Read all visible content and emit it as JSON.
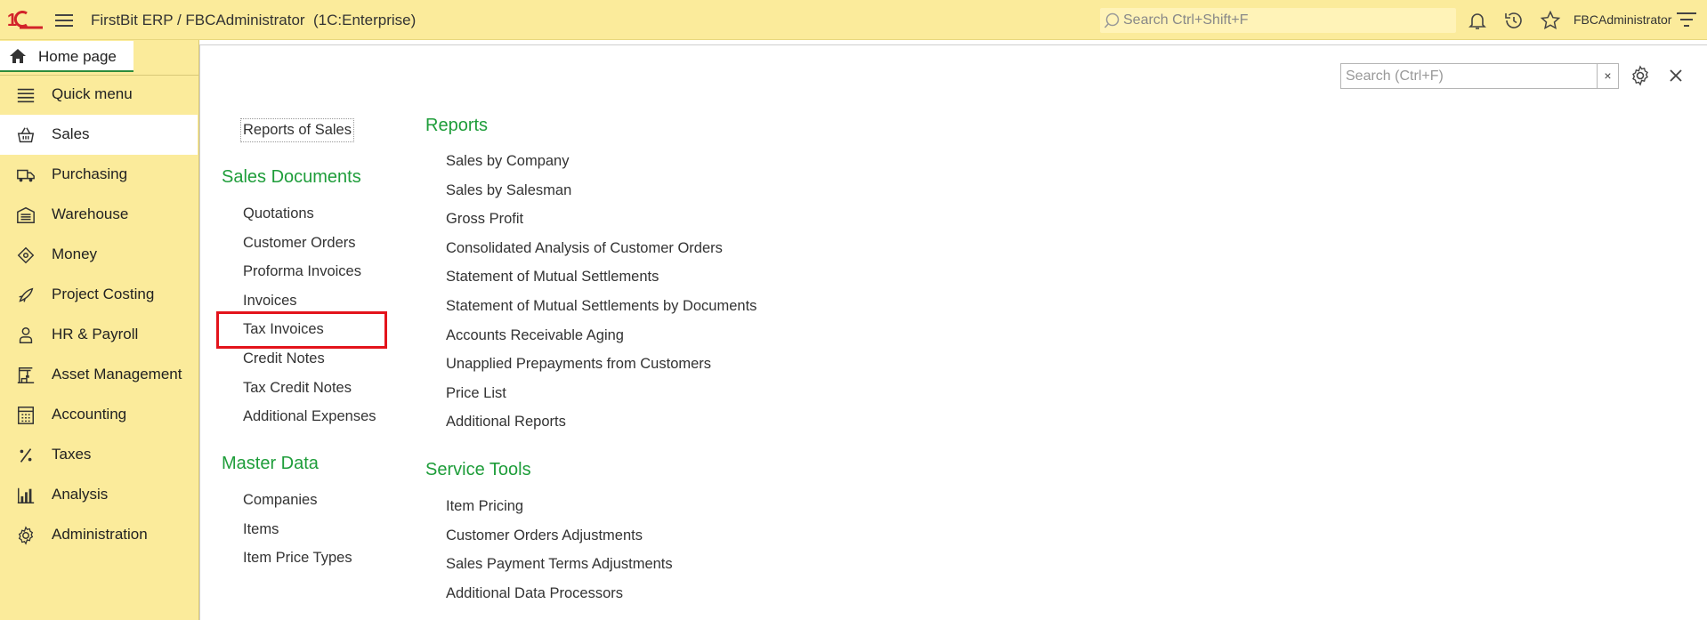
{
  "topbar": {
    "title": "FirstBit ERP / FBCAdministrator  (1C:Enterprise)",
    "search_placeholder": "Search Ctrl+Shift+F",
    "user": "FBCAdministrator"
  },
  "home_tab": "Home page",
  "sidebar": {
    "items": [
      {
        "label": "Quick menu",
        "icon": "list-icon"
      },
      {
        "label": "Sales",
        "icon": "basket-icon"
      },
      {
        "label": "Purchasing",
        "icon": "truck-icon"
      },
      {
        "label": "Warehouse",
        "icon": "warehouse-icon"
      },
      {
        "label": "Money",
        "icon": "money-icon"
      },
      {
        "label": "Project Costing",
        "icon": "rocket-icon"
      },
      {
        "label": "HR & Payroll",
        "icon": "person-icon"
      },
      {
        "label": "Asset Management",
        "icon": "crane-icon"
      },
      {
        "label": "Accounting",
        "icon": "calculator-icon"
      },
      {
        "label": "Taxes",
        "icon": "percent-icon"
      },
      {
        "label": "Analysis",
        "icon": "bar-chart-icon"
      },
      {
        "label": "Administration",
        "icon": "gear-icon"
      }
    ],
    "active": "Sales"
  },
  "panel": {
    "search_placeholder": "Search (Ctrl+F)",
    "clear": "×",
    "reports_of_sales": "Reports of Sales",
    "sales_documents": {
      "title": "Sales Documents",
      "items": [
        "Quotations",
        "Customer Orders",
        "Proforma Invoices",
        "Invoices",
        "Tax Invoices",
        "Credit Notes",
        "Tax Credit Notes",
        "Additional Expenses"
      ]
    },
    "master_data": {
      "title": "Master Data",
      "items": [
        "Companies",
        "Items",
        "Item Price Types"
      ]
    },
    "reports": {
      "title": "Reports",
      "items": [
        "Sales by Company",
        "Sales by Salesman",
        "Gross Profit",
        "Consolidated Analysis of Customer Orders",
        "Statement of Mutual Settlements",
        "Statement of Mutual Settlements by Documents",
        "Accounts Receivable Aging",
        "Unapplied Prepayments from Customers",
        "Price List",
        "Additional Reports"
      ]
    },
    "service_tools": {
      "title": "Service Tools",
      "items": [
        "Item Pricing",
        "Customer Orders Adjustments",
        "Sales Payment Terms Adjustments",
        "Additional Data Processors"
      ]
    }
  }
}
